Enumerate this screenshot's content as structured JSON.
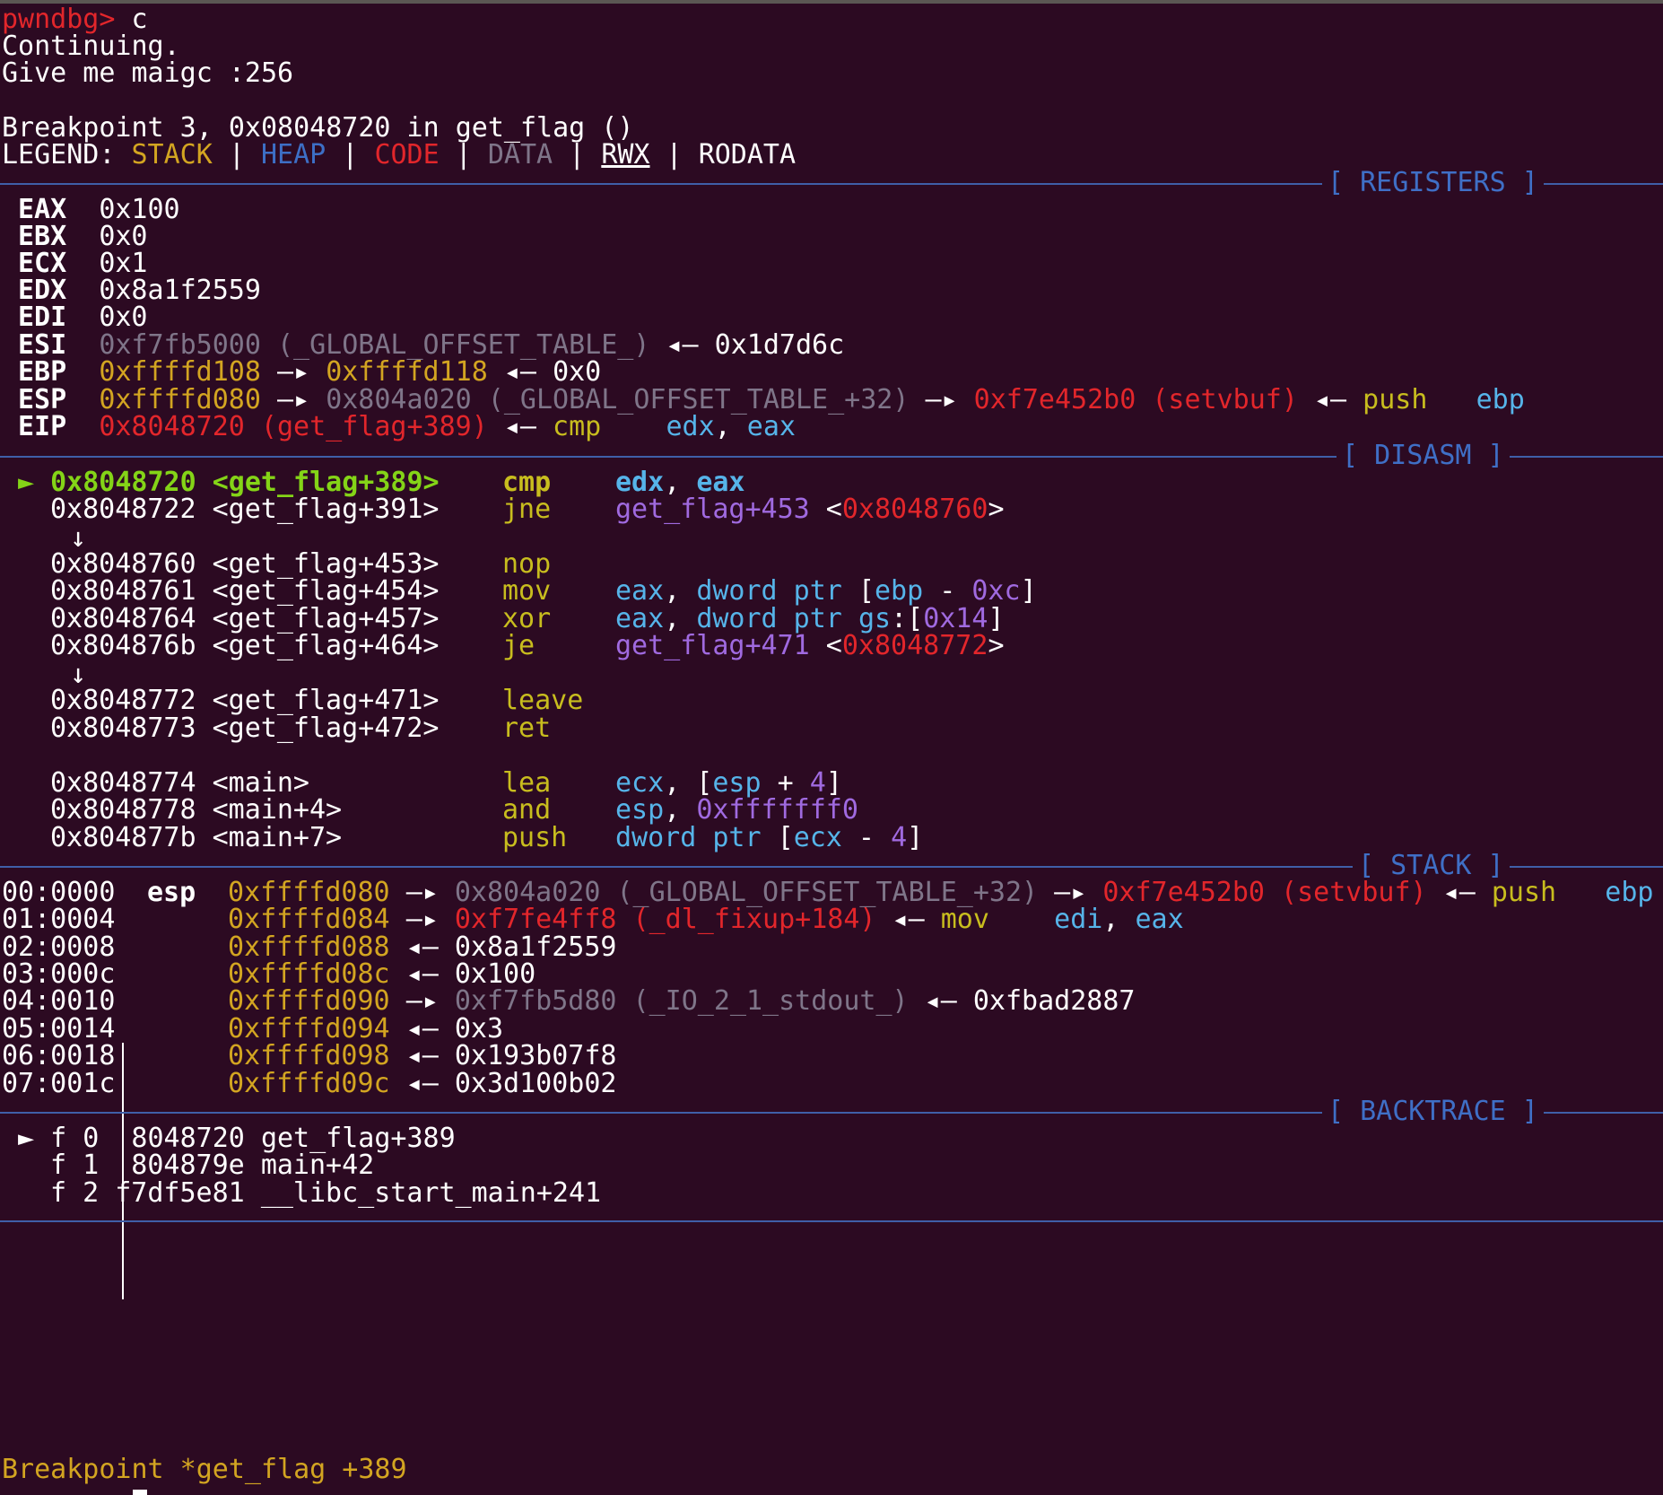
{
  "header": {
    "prompt": "pwndbg>",
    "command": " c",
    "continuing": "Continuing.",
    "program_output": "Give me maigc :256",
    "breakpoint_line": "Breakpoint 3, 0x08048720 in get_flag ()",
    "legend_label": "LEGEND: ",
    "legend_stack": "STACK",
    "legend_heap": "HEAP",
    "legend_code": "CODE",
    "legend_data": "DATA",
    "legend_rwx": "RWX",
    "legend_rodata": "RODATA",
    "legend_sep": " | "
  },
  "sections": {
    "registers": "[ REGISTERS ]",
    "disasm": "[ DISASM ]",
    "stack": "[ STACK ]",
    "backtrace": "[ BACKTRACE ]"
  },
  "arrows": {
    "right": "—▸",
    "left": "◂—"
  },
  "registers": {
    "eax": {
      "name": "EAX",
      "value": "0x100"
    },
    "ebx": {
      "name": "EBX",
      "value": "0x0"
    },
    "ecx": {
      "name": "ECX",
      "value": "0x1"
    },
    "edx": {
      "name": "EDX",
      "value": "0x8a1f2559"
    },
    "edi": {
      "name": "EDI",
      "value": "0x0"
    },
    "esi": {
      "name": "ESI",
      "value": "0xf7fb5000 (_GLOBAL_OFFSET_TABLE_)",
      "target": "0x1d7d6c"
    },
    "ebp": {
      "name": "EBP",
      "value": "0xffffd108",
      "ptr": "0xffffd118",
      "target": "0x0"
    },
    "esp": {
      "name": "ESP",
      "value": "0xffffd080",
      "ptr": "0x804a020 (_GLOBAL_OFFSET_TABLE_+32)",
      "ptr2": "0xf7e452b0 (setvbuf)",
      "ins_mnem": "push",
      "ins_op": "ebp"
    },
    "eip": {
      "name": "EIP",
      "value": "0x8048720 (get_flag+389)",
      "ins_mnem": "cmp",
      "ins_op1": "edx",
      "ins_op2": "eax"
    }
  },
  "disasm": {
    "current_marker": "►",
    "jump_marker": "↓",
    "rows": [
      {
        "addr": "0x8048720",
        "sym": "<get_flag+389>",
        "mnem": "cmp"
      },
      {
        "addr": "0x8048722",
        "sym": "<get_flag+391>",
        "mnem": "jne",
        "target_sym": "get_flag+453",
        "target_addr": "0x8048760"
      },
      {
        "addr": "0x8048760",
        "sym": "<get_flag+453>",
        "mnem": "nop"
      },
      {
        "addr": "0x8048761",
        "sym": "<get_flag+454>",
        "mnem": "mov"
      },
      {
        "addr": "0x8048764",
        "sym": "<get_flag+457>",
        "mnem": "xor"
      },
      {
        "addr": "0x804876b",
        "sym": "<get_flag+464>",
        "mnem": "je",
        "target_sym": "get_flag+471",
        "target_addr": "0x8048772"
      },
      {
        "addr": "0x8048772",
        "sym": "<get_flag+471>",
        "mnem": "leave"
      },
      {
        "addr": "0x8048773",
        "sym": "<get_flag+472>",
        "mnem": "ret"
      },
      {
        "addr": "0x8048774",
        "sym": "<main>",
        "mnem": "lea"
      },
      {
        "addr": "0x8048778",
        "sym": "<main+4>",
        "mnem": "and"
      },
      {
        "addr": "0x804877b",
        "sym": "<main+7>",
        "mnem": "push"
      }
    ],
    "tokens": {
      "edx": "edx",
      "eax": "eax",
      "esp": "esp",
      "ecx": "ecx",
      "ebp": "ebp",
      "dword_ptr": "dword ptr",
      "gs": "gs",
      "off_c": "0xc",
      "off_14": "0x14",
      "four": "4",
      "mask": "0xfffffff0",
      "minus": " - ",
      "plus": " + "
    }
  },
  "stack": {
    "esp_label": "esp",
    "rows": [
      {
        "idx": "00:0000",
        "addr": "0xffffd080",
        "val": "0x804a020 (_GLOBAL_OFFSET_TABLE_+32)",
        "val2": "0xf7e452b0 (setvbuf)",
        "mnem": "push",
        "op": "ebp"
      },
      {
        "idx": "01:0004",
        "addr": "0xffffd084",
        "val": "0xf7fe4ff8 (_dl_fixup+184)",
        "mnem": "mov",
        "op1": "edi",
        "op2": "eax"
      },
      {
        "idx": "02:0008",
        "addr": "0xffffd088",
        "val": "0x8a1f2559"
      },
      {
        "idx": "03:000c",
        "addr": "0xffffd08c",
        "val": "0x100"
      },
      {
        "idx": "04:0010",
        "addr": "0xffffd090",
        "val": "0xf7fb5d80 (_IO_2_1_stdout_)",
        "target": "0xfbad2887"
      },
      {
        "idx": "05:0014",
        "addr": "0xffffd094",
        "val": "0x3"
      },
      {
        "idx": "06:0018",
        "addr": "0xffffd098",
        "val": "0x193b07f8"
      },
      {
        "idx": "07:001c",
        "addr": "0xffffd09c",
        "val": "0x3d100b02"
      }
    ]
  },
  "backtrace": {
    "marker": "►",
    "frames": [
      {
        "label": "f 0",
        "addr": " 8048720",
        "sym": "get_flag+389"
      },
      {
        "label": "f 1",
        "addr": " 804879e",
        "sym": "main+42"
      },
      {
        "label": "f 2",
        "addr": "f7df5e81",
        "sym": "__libc_start_main+241"
      }
    ]
  },
  "footer": {
    "status": "Breakpoint *get_flag +389"
  },
  "colors": {
    "background": "#2c0a22",
    "prompt": "#e2262b",
    "stack": "#d3a521",
    "heap": "#3d6fc6",
    "code": "#e2262b",
    "data": "#7f7589",
    "mnemonic": "#c8bd1e",
    "register": "#3d8fe6",
    "immediate": "#a06ae0",
    "current": "#84d417"
  }
}
